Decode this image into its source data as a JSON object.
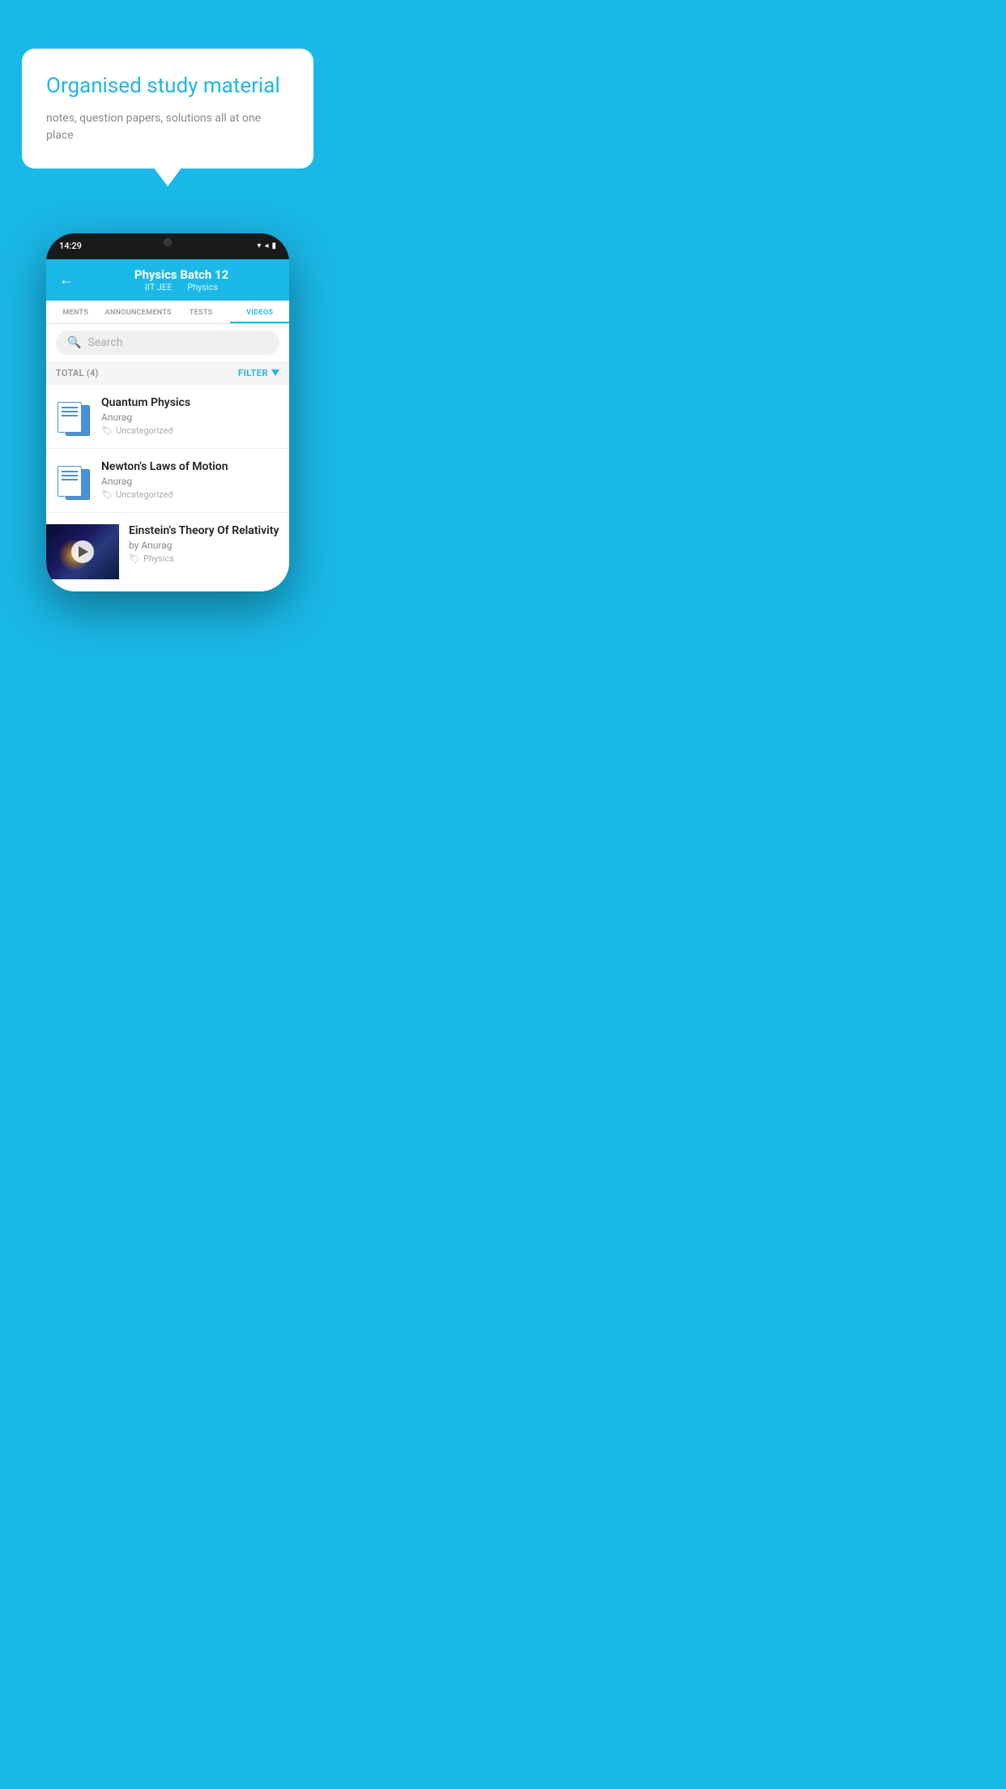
{
  "app": {
    "background_color": "#1ab8e8"
  },
  "speech_bubble": {
    "heading": "Organised study material",
    "subtext": "notes, question papers, solutions all at one place"
  },
  "phone": {
    "status_bar": {
      "time": "14:29",
      "wifi": "▼",
      "signal": "◂",
      "battery": "▮"
    },
    "header": {
      "back_label": "←",
      "batch_name": "Physics Batch 12",
      "tag1": "IIT JEE",
      "tag2": "Physics"
    },
    "tabs": [
      {
        "label": "MENTS",
        "active": false
      },
      {
        "label": "ANNOUNCEMENTS",
        "active": false
      },
      {
        "label": "TESTS",
        "active": false
      },
      {
        "label": "VIDEOS",
        "active": true
      }
    ],
    "search": {
      "placeholder": "Search"
    },
    "filter_row": {
      "total_label": "TOTAL (4)",
      "filter_label": "FILTER"
    },
    "videos": [
      {
        "title": "Quantum Physics",
        "author": "Anurag",
        "tag": "Uncategorized",
        "has_thumbnail": false
      },
      {
        "title": "Newton's Laws of Motion",
        "author": "Anurag",
        "tag": "Uncategorized",
        "has_thumbnail": false
      },
      {
        "title": "Einstein's Theory Of Relativity",
        "author": "by Anurag",
        "tag": "Physics",
        "has_thumbnail": true
      }
    ]
  }
}
